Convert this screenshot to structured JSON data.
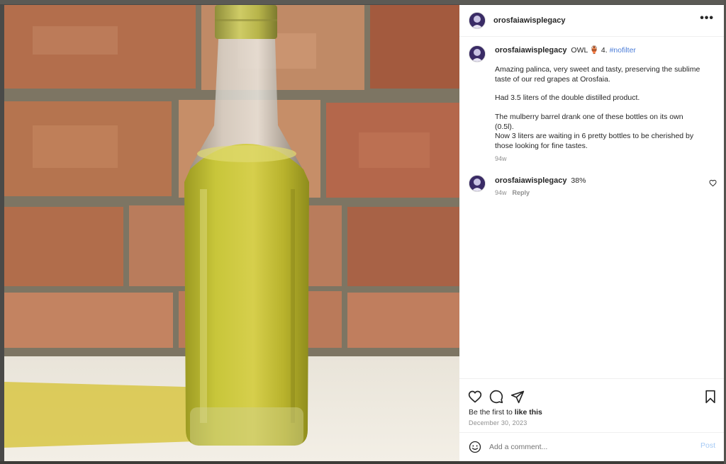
{
  "post": {
    "author": "orosfaiawisplegacy",
    "more_icon": "more-horizontal-icon",
    "caption": {
      "author": "orosfaiawisplegacy",
      "title_text": "OWL",
      "emoji": "🏺",
      "number": "4.",
      "hashtag": "#nofilter",
      "paragraphs": [
        "Amazing palinca, very sweet and tasty, preserving the sublime taste of our red grapes at Orosfaia.",
        "Had 3.5 liters of the double distilled product.",
        "The mulberry barrel drank one of these bottles on its own (0.5l).",
        "Now 3 liters are waiting in 6 pretty bottles to be cherished by those looking for fine tastes."
      ],
      "time": "94w"
    },
    "comments": [
      {
        "author": "orosfaiawisplegacy",
        "text": "38%",
        "time": "94w",
        "reply_label": "Reply",
        "like_icon": "heart-outline-icon"
      }
    ],
    "actions": {
      "like_icon": "heart-outline-icon",
      "comment_icon": "speech-bubble-icon",
      "share_icon": "paper-plane-icon",
      "save_icon": "bookmark-icon"
    },
    "likes_prefix": "Be the first to",
    "likes_link": "like this",
    "date": "December 30, 2023",
    "add_comment": {
      "emoji_icon": "smiley-icon",
      "placeholder": "Add a comment...",
      "post_label": "Post"
    }
  },
  "colors": {
    "hashtag": "#4d7ed8",
    "post_button": "#a4c9f5",
    "muted_text": "#8e8e8e"
  }
}
